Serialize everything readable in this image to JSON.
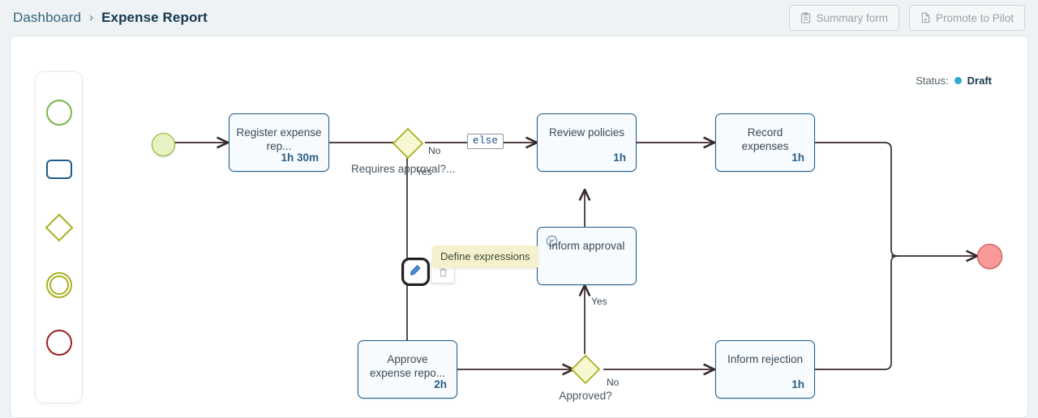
{
  "breadcrumb": {
    "root": "Dashboard",
    "separator": "›",
    "current": "Expense Report"
  },
  "toolbar": {
    "summary_form_label": "Summary form",
    "summary_form_icon": "clipboard-icon",
    "promote_label": "Promote to Pilot",
    "promote_icon": "file-play-icon"
  },
  "status": {
    "label": "Status:",
    "value": "Draft",
    "dot_color": "#2eaad4"
  },
  "palette": {
    "items": [
      {
        "name": "start-event",
        "icon": "circle-green-icon",
        "color": "#7ab648"
      },
      {
        "name": "task",
        "icon": "rounded-rect-blue-icon",
        "color": "#1e5b8d"
      },
      {
        "name": "gateway",
        "icon": "diamond-olive-icon",
        "color": "#a8b020"
      },
      {
        "name": "intermediate-event",
        "icon": "double-circle-olive-icon",
        "color": "#a8b020"
      },
      {
        "name": "end-event",
        "icon": "circle-red-icon",
        "color": "#9e2020"
      }
    ]
  },
  "diagram": {
    "events": [
      {
        "id": "start",
        "type": "start",
        "fill": "#e6f2c2",
        "stroke": "#8ab52e"
      },
      {
        "id": "end",
        "type": "end",
        "fill": "#f99a9a",
        "stroke": "#d14343"
      }
    ],
    "tasks": [
      {
        "id": "register",
        "label": "Register expense rep...",
        "duration": "1h 30m"
      },
      {
        "id": "review",
        "label": "Review policies",
        "duration": "1h"
      },
      {
        "id": "record",
        "label": "Record expenses",
        "duration": "1h"
      },
      {
        "id": "inform-approval",
        "label": "Inform approval",
        "duration": "",
        "badge": "message-icon"
      },
      {
        "id": "approve",
        "label": "Approve expense repo...",
        "duration": "2h"
      },
      {
        "id": "inform-rejection",
        "label": "Inform rejection",
        "duration": "1h"
      }
    ],
    "gateways": [
      {
        "id": "requires-approval",
        "label": "Requires approval?..."
      },
      {
        "id": "approved",
        "label": "Approved?"
      }
    ],
    "edge_labels": [
      {
        "id": "gw1-no",
        "text": "No"
      },
      {
        "id": "gw1-yes",
        "text": "Yes"
      },
      {
        "id": "gw2-yes",
        "text": "Yes"
      },
      {
        "id": "gw2-no",
        "text": "No"
      }
    ],
    "expression_chip": "else"
  },
  "node_toolbar": {
    "tooltip": "Define expressions",
    "define_expressions_icon": "pen-icon",
    "delete_icon": "trash-icon"
  }
}
